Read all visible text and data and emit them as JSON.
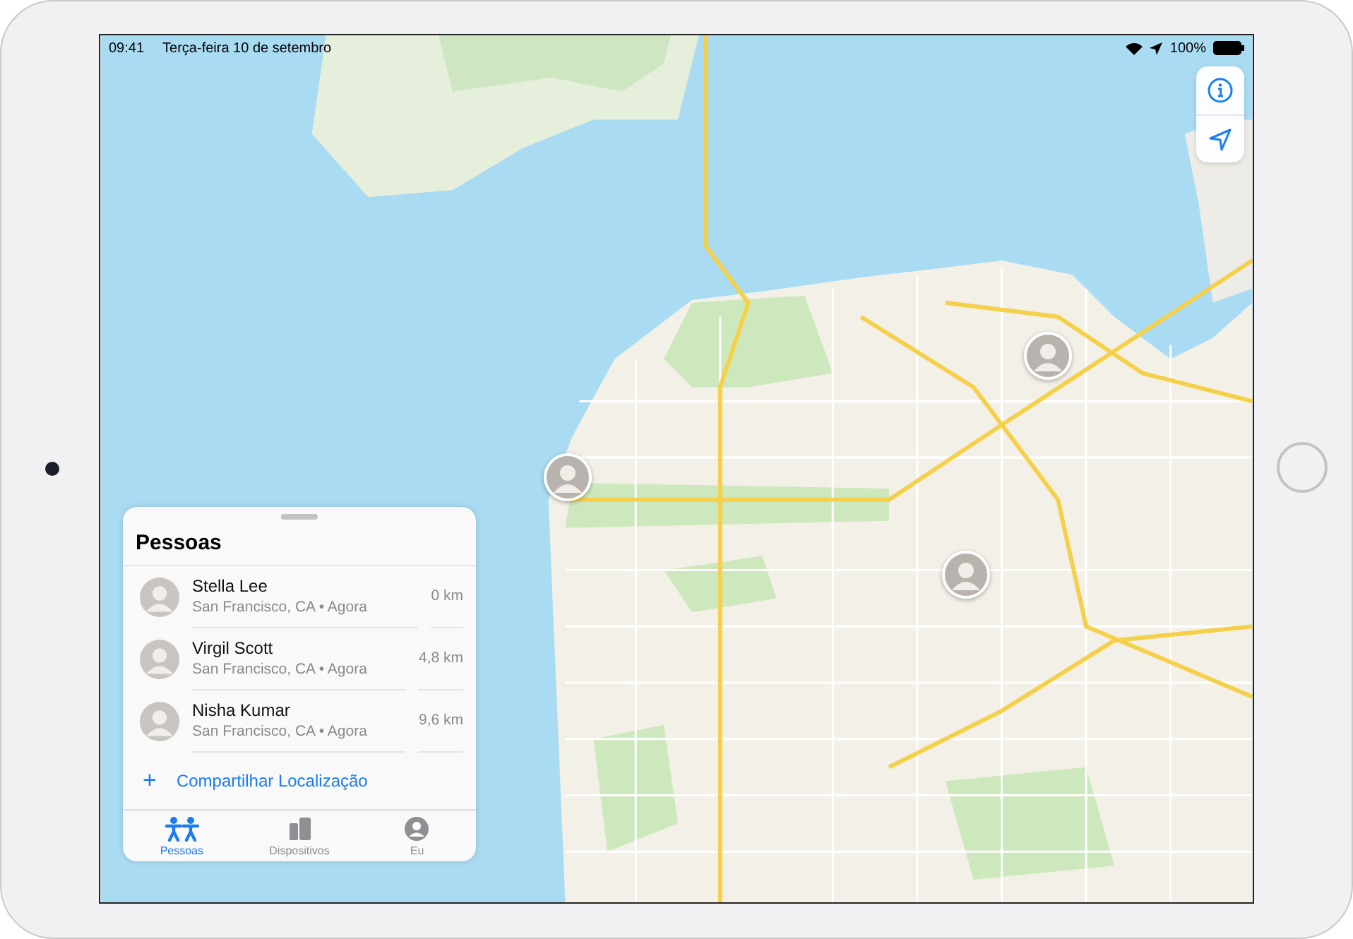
{
  "status_bar": {
    "time": "09:41",
    "date": "Terça-feira 10 de setembro",
    "battery": "100%"
  },
  "people_panel": {
    "title": "Pessoas",
    "people": [
      {
        "name": "Stella Lee",
        "location": "San Francisco, CA • Agora",
        "distance": "0 km"
      },
      {
        "name": "Virgil Scott",
        "location": "San Francisco, CA • Agora",
        "distance": "4,8 km"
      },
      {
        "name": "Nisha Kumar",
        "location": "San Francisco, CA • Agora",
        "distance": "9,6 km"
      }
    ],
    "add_action": {
      "icon": "+",
      "label": "Compartilhar Localização"
    }
  },
  "tab_bar": [
    {
      "label": "Pessoas",
      "selected": true
    },
    {
      "label": "Dispositivos",
      "selected": false
    },
    {
      "label": "Eu",
      "selected": false
    }
  ]
}
